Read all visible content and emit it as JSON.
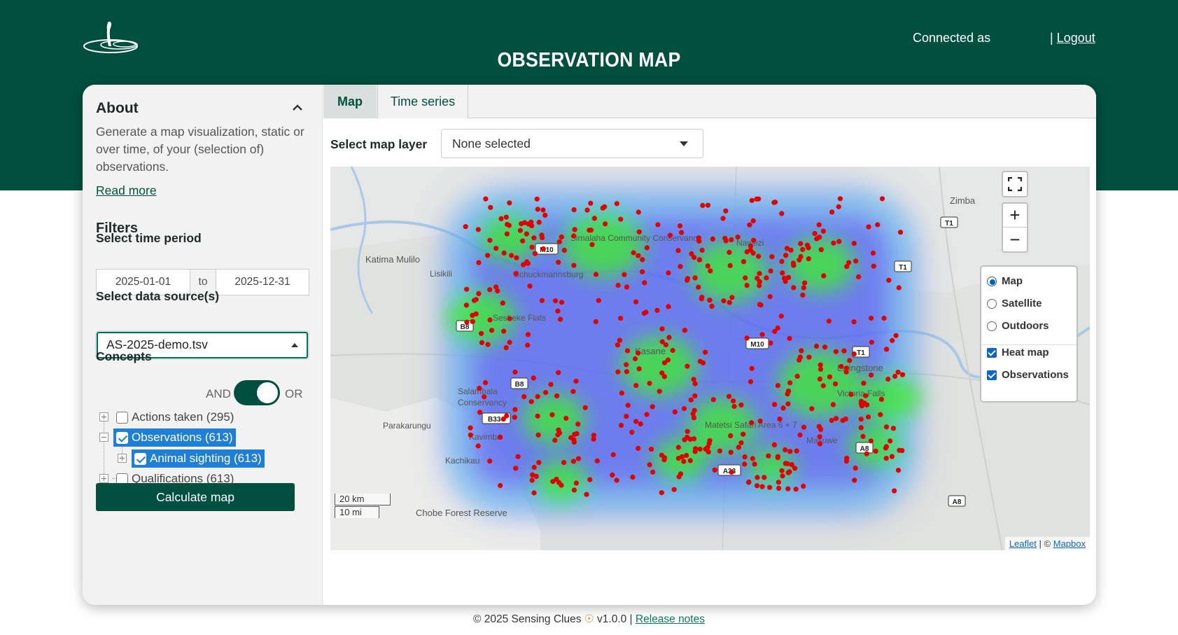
{
  "header": {
    "title": "OBSERVATION MAP",
    "connected_as": "Connected as",
    "separator": "|",
    "logout": "Logout"
  },
  "about": {
    "heading": "About",
    "text": "Generate a map visualization, static or over time, of your (selection of) observations.",
    "read_more": "Read more"
  },
  "filters": {
    "heading": "Filters",
    "time_period_label": "Select time period",
    "date_from": "2025-01-01",
    "date_to_sep": "to",
    "date_to": "2025-12-31",
    "data_source_label": "Select data source(s)",
    "data_source_value": "AS-2025-demo.tsv",
    "concepts_label": "Concepts",
    "and_label": "AND",
    "or_label": "OR",
    "concepts": [
      {
        "label": "Actions taken (295)",
        "checked": false,
        "selected": false
      },
      {
        "label": "Observations (613)",
        "checked": true,
        "selected": true
      },
      {
        "label": "Animal sighting (613)",
        "checked": true,
        "selected": true
      },
      {
        "label": "Qualifications (613)",
        "checked": false,
        "selected": false
      }
    ],
    "calculate_button": "Calculate map"
  },
  "tabs": [
    {
      "label": "Map",
      "active": true
    },
    {
      "label": "Time series",
      "active": false
    }
  ],
  "map_layer": {
    "label": "Select map layer",
    "value": "None selected"
  },
  "map": {
    "zoom_in": "+",
    "zoom_out": "−",
    "base_layers": [
      {
        "label": "Map",
        "selected": true
      },
      {
        "label": "Satellite",
        "selected": false
      },
      {
        "label": "Outdoors",
        "selected": false
      }
    ],
    "overlays": [
      {
        "label": "Heat map",
        "checked": true
      },
      {
        "label": "Observations",
        "checked": true
      }
    ],
    "place_labels": [
      "Zimba",
      "Katima Mulilo",
      "Lisikili",
      "Simalaha Community Conservancy",
      "Schuckmannsburg",
      "Nawezi",
      "Sesheke Flats",
      "Kasane",
      "Livingstone",
      "Victoria Falls",
      "Salambala Conservancy",
      "Kavimba",
      "Parakarungu",
      "Kachikau",
      "Matetsi Safari Area 6 + 7",
      "Masuwe",
      "Chobe Forest Reserve"
    ],
    "road_labels": [
      "T1",
      "M10",
      "T1",
      "B8",
      "M10",
      "B8",
      "T1",
      "A8",
      "A33",
      "A8",
      "B334"
    ],
    "scale_km": "20 km",
    "scale_mi": "10 mi",
    "attribution_leaflet": "Leaflet",
    "attribution_sep": "| ©",
    "attribution_mapbox": "Mapbox",
    "heat_color_hot": "#3ef02a",
    "observation_color": "#e00000"
  },
  "footer": {
    "copyright": "© 2025 Sensing Clues",
    "version": "v1.0.0 |",
    "release_notes": "Release notes"
  }
}
